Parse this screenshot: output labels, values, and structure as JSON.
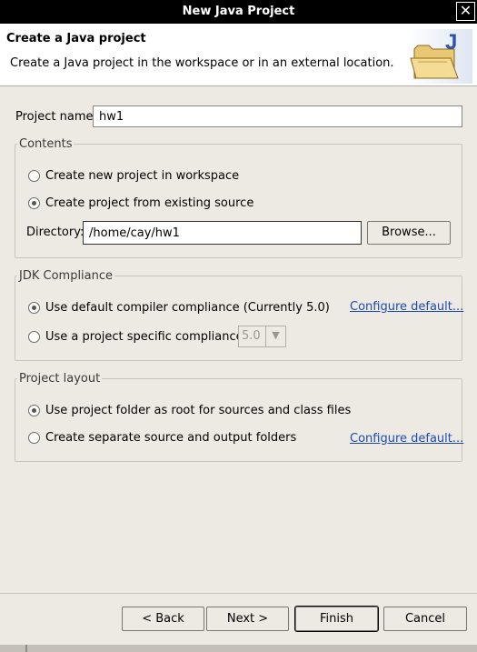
{
  "window": {
    "title": "New Java Project",
    "close_glyph": "✕"
  },
  "banner": {
    "title": "Create a Java project",
    "description": "Create a Java project in the workspace or in an external location.",
    "icon": "java-project-folder-icon"
  },
  "project_name": {
    "label": "Project name:",
    "value": "hw1"
  },
  "contents": {
    "legend": "Contents",
    "option_new": "Create new project in workspace",
    "option_existing": "Create project from existing source",
    "selected": "existing",
    "directory_label": "Directory:",
    "directory_value": "/home/cay/hw1",
    "browse_label": "Browse..."
  },
  "jdk": {
    "legend": "JDK Compliance",
    "option_default": "Use default compiler compliance (Currently 5.0)",
    "option_specific": "Use a project specific compliance:",
    "selected": "default",
    "configure_link": "Configure default...",
    "compliance_value": "5.0"
  },
  "layout": {
    "legend": "Project layout",
    "option_root": "Use project folder as root for sources and class files",
    "option_separate": "Create separate source and output folders",
    "selected": "root",
    "configure_link": "Configure default..."
  },
  "buttons": {
    "back": "< Back",
    "next": "Next >",
    "finish": "Finish",
    "cancel": "Cancel"
  },
  "colors": {
    "link": "#1d4bb0",
    "titlebar": "#000000",
    "background": "#ede9e3"
  }
}
